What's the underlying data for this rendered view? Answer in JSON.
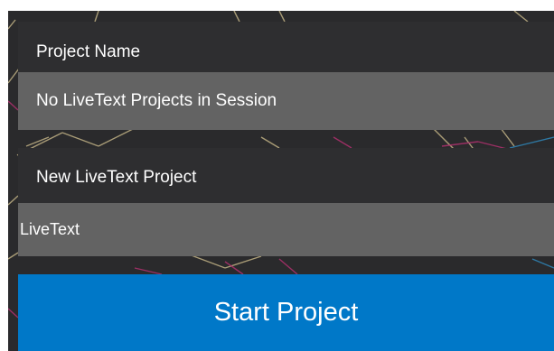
{
  "form": {
    "project_name_label": "Project Name",
    "project_select_value": "No LiveText Projects in Session",
    "new_project_label": "New LiveText Project",
    "new_project_value": "LiveText",
    "start_button_label": "Start Project"
  },
  "colors": {
    "panel_background": "#2a2a2c",
    "field_background": "#636363",
    "button_accent": "#0078c8",
    "text": "#ffffff"
  }
}
